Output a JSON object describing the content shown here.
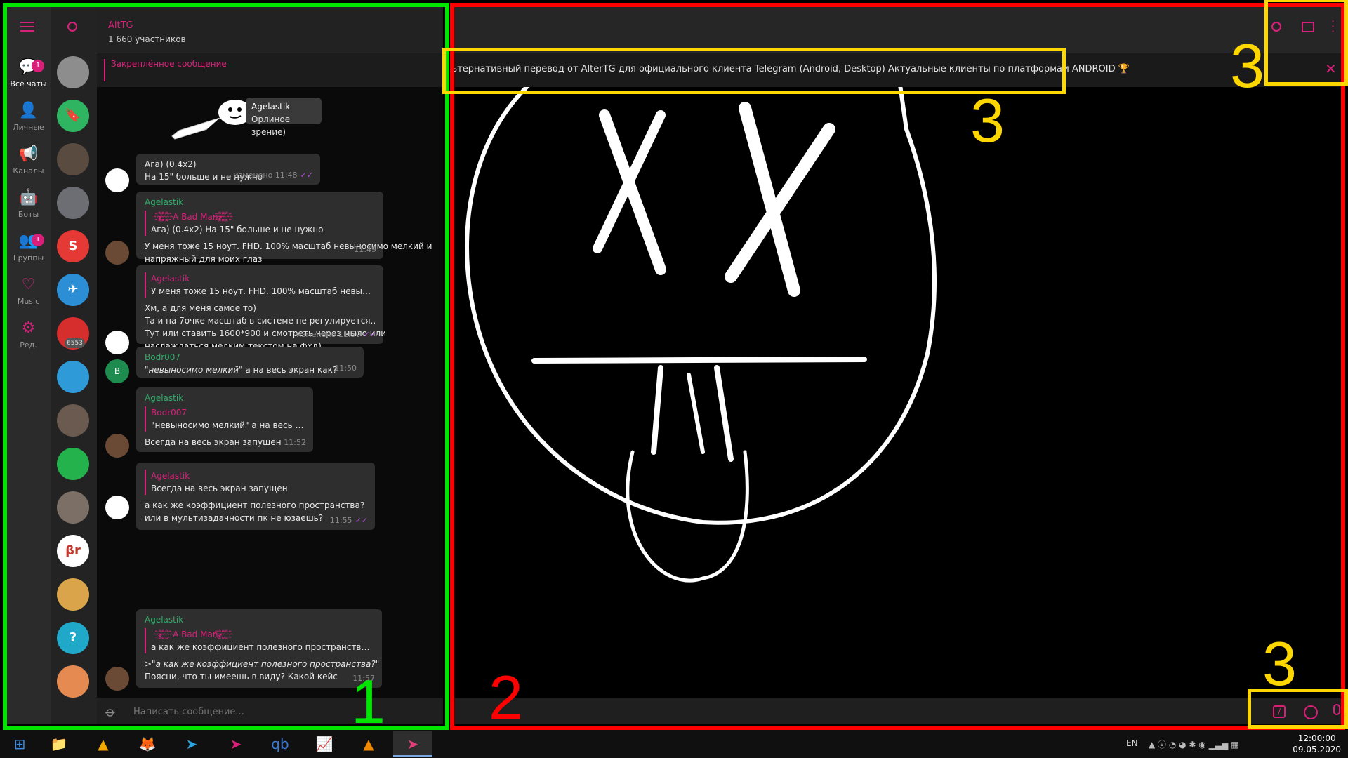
{
  "folders": [
    {
      "label": "Все чаты",
      "icon": "chat-bubbles-icon",
      "glyph": "💬",
      "badge": "1",
      "active": true
    },
    {
      "label": "Личные",
      "icon": "user-icon",
      "glyph": "👤",
      "badge": ""
    },
    {
      "label": "Каналы",
      "icon": "megaphone-icon",
      "glyph": "📢",
      "badge": ""
    },
    {
      "label": "Боты",
      "icon": "robot-icon",
      "glyph": "🤖",
      "badge": ""
    },
    {
      "label": "Группы",
      "icon": "group-icon",
      "glyph": "👥",
      "badge": "1"
    },
    {
      "label": "Music",
      "icon": "heart-icon",
      "glyph": "♡",
      "badge": ""
    },
    {
      "label": "Ред.",
      "icon": "sliders-icon",
      "glyph": "⚙",
      "badge": ""
    }
  ],
  "dialogs": [
    {
      "name": "dialog-1",
      "color": "#8d8d8d",
      "text": "",
      "badge": ""
    },
    {
      "name": "saved-messages",
      "color": "#2fb561",
      "text": "🔖",
      "badge": ""
    },
    {
      "name": "dialog-3",
      "color": "#5a4b41",
      "text": "",
      "badge": ""
    },
    {
      "name": "dialog-4",
      "color": "#6d6e73",
      "text": "",
      "badge": ""
    },
    {
      "name": "dialog-5",
      "color": "#e53935",
      "text": "S",
      "badge": ""
    },
    {
      "name": "dialog-6",
      "color": "#2c8fd6",
      "text": "✈",
      "badge": ""
    },
    {
      "name": "dialog-7",
      "color": "#d62d2d",
      "text": "",
      "badge": "6553"
    },
    {
      "name": "dialog-8",
      "color": "#2e9bd8",
      "text": "",
      "badge": ""
    },
    {
      "name": "dialog-9",
      "color": "#6a5a4f",
      "text": "",
      "badge": ""
    },
    {
      "name": "dialog-10",
      "color": "#23b24c",
      "text": "",
      "badge": ""
    },
    {
      "name": "dialog-11",
      "color": "#7b6f66",
      "text": "",
      "badge": ""
    },
    {
      "name": "dialog-12",
      "color": "#ffffff",
      "text": "βr",
      "badge": ""
    },
    {
      "name": "dialog-13",
      "color": "#d9a44a",
      "text": "",
      "badge": ""
    },
    {
      "name": "dialog-14",
      "color": "#20a8c8",
      "text": "?",
      "badge": ""
    },
    {
      "name": "dialog-15",
      "color": "#e58b52",
      "text": "",
      "badge": ""
    }
  ],
  "chat": {
    "title": "AltTG",
    "members": "1 660 участников",
    "pinned_label": "Закреплённое сообщение",
    "pinned_text": "Все клиенты и переводы | Прокси-монитор | FAQ | Правила чата 🇷🇺 Альтернативный перевод от AlterTG для официального клиента Telegram (Android, Desktop)  Актуальные клиенты по платформам  ANDROID 🏆",
    "composer_placeholder": "Написать сообщение..."
  },
  "messages": {
    "sticker_reply": {
      "author": "Agelastik",
      "text": "Орлиное зрение)"
    },
    "m1": {
      "lines": [
        "Ага) (0.4х2)",
        "На 15\" больше и не нужно"
      ],
      "time": "изменено 11:48",
      "read": "✓✓"
    },
    "m2": {
      "author": "Agelastik",
      "quote_author": "҂҈҈҈A Bad Man҂҈҈҈",
      "quote_text": "Ага) (0.4х2) На 15\" больше и не нужно",
      "lines": [
        "У меня тоже 15 ноут. FHD. 100% масштаб невыносимо мелкий и",
        "напряжный для моих глаз"
      ],
      "time": "11:49"
    },
    "m3": {
      "quote_author": "Agelastik",
      "quote_text": "У меня тоже 15 ноут. FHD. 100% масштаб невыносимо мелки...",
      "lines": [
        "Хм, а для меня самое то)",
        "Та и на 7очке масштаб в системе не регулируется..",
        "Тут или ставить 1600*900 и смотреть через мыло или",
        "наслаждаться мелким текстом на фхд)"
      ],
      "time": "изменено 11:50",
      "read": "✓✓"
    },
    "m4": {
      "author": "Bodr007",
      "avatar_letter": "B",
      "italic": "\"невыносимо мелкий\"",
      "rest": " а на весь экран как?",
      "time": "11:50"
    },
    "m5": {
      "author": "Agelastik",
      "quote_author": "Bodr007",
      "quote_text": "\"невыносимо мелкий\" а на весь э...",
      "lines": [
        "Всегда на весь экран запущен"
      ],
      "time": "11:52"
    },
    "m6": {
      "quote_author": "Agelastik",
      "quote_text": "Всегда на весь экран запущен",
      "lines": [
        "а как же коэффициент полезного пространства?",
        "или в мультизадачности пк не юзаешь?"
      ],
      "time": "11:55",
      "read": "✓✓"
    },
    "m7": {
      "author": "Agelastik",
      "quote_author": "҂҈҈҈A Bad Man҂҈҈҈",
      "quote_text": "а как же коэффициент полезного пространства? ...",
      "italic": ">\"а как же коэффициент полезного пространства?\"",
      "lines": [
        "Поясни, что ты имеешь в виду? Какой кейс"
      ],
      "time": "11:57"
    }
  },
  "annotations": {
    "zone1": "1",
    "zone2": "2",
    "zone3a": "3",
    "zone3b": "3",
    "zone3c": "3",
    "green": "#00e600",
    "red": "#ff0000",
    "yellow": "#ffd700"
  },
  "taskbar": {
    "apps": [
      {
        "name": "start-button",
        "glyph": "⊞",
        "color": "#3d8ee6",
        "on": false
      },
      {
        "name": "taskbar-file-explorer",
        "glyph": "📁",
        "color": "#f2c14e",
        "on": false
      },
      {
        "name": "taskbar-app-triangle",
        "glyph": "▲",
        "color": "#f2a900",
        "on": false
      },
      {
        "name": "taskbar-firefox",
        "glyph": "🦊",
        "color": "#ff7139",
        "on": false
      },
      {
        "name": "taskbar-telegram",
        "glyph": "➤",
        "color": "#2ca5e0",
        "on": false
      },
      {
        "name": "taskbar-telegram-alt",
        "glyph": "➤",
        "color": "#d8207a",
        "on": false
      },
      {
        "name": "taskbar-qbittorrent",
        "glyph": "qb",
        "color": "#3f7ad6",
        "on": false
      },
      {
        "name": "taskbar-notepad",
        "glyph": "📈",
        "color": "#9cc54a",
        "on": false
      },
      {
        "name": "taskbar-vlc",
        "glyph": "▲",
        "color": "#f08a00",
        "on": false
      },
      {
        "name": "taskbar-telegram-active",
        "glyph": "➤",
        "color": "#e0407a",
        "on": true
      }
    ],
    "lang": "EN",
    "time": "12:00:00",
    "date": "09.05.2020"
  }
}
